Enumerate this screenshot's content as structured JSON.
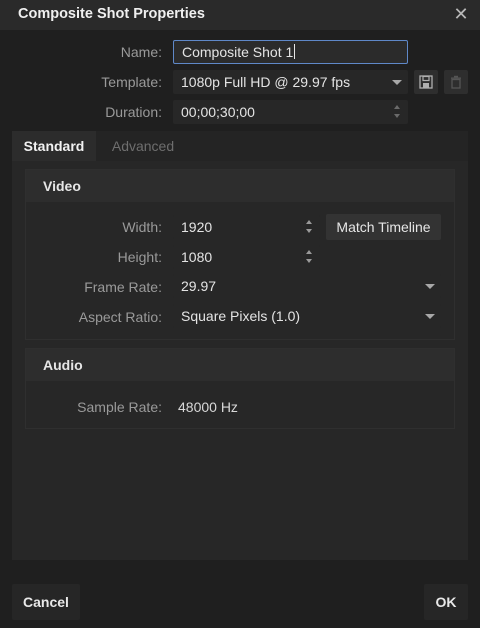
{
  "dialog": {
    "title": "Composite Shot Properties",
    "close_icon": "close-icon"
  },
  "general": {
    "name_label": "Name:",
    "name_value": "Composite Shot 1",
    "template_label": "Template:",
    "template_value": "1080p Full HD @ 29.97 fps",
    "duration_label": "Duration:",
    "duration_value": "00;00;30;00",
    "save_template_icon": "save-icon",
    "delete_template_icon": "trash-icon"
  },
  "tabs": [
    {
      "label": "Standard",
      "active": true
    },
    {
      "label": "Advanced",
      "active": false
    }
  ],
  "video": {
    "header": "Video",
    "width_label": "Width:",
    "width_value": "1920",
    "height_label": "Height:",
    "height_value": "1080",
    "match_timeline_label": "Match Timeline",
    "frame_rate_label": "Frame Rate:",
    "frame_rate_value": "29.97",
    "aspect_ratio_label": "Aspect Ratio:",
    "aspect_ratio_value": "Square Pixels (1.0)"
  },
  "audio": {
    "header": "Audio",
    "sample_rate_label": "Sample Rate:",
    "sample_rate_value": "48000 Hz"
  },
  "footer": {
    "cancel_label": "Cancel",
    "ok_label": "OK"
  },
  "colors": {
    "background": "#1f1f1f",
    "field": "#272727",
    "focus_border": "#5f88c8",
    "text": "#d6d6d6"
  }
}
